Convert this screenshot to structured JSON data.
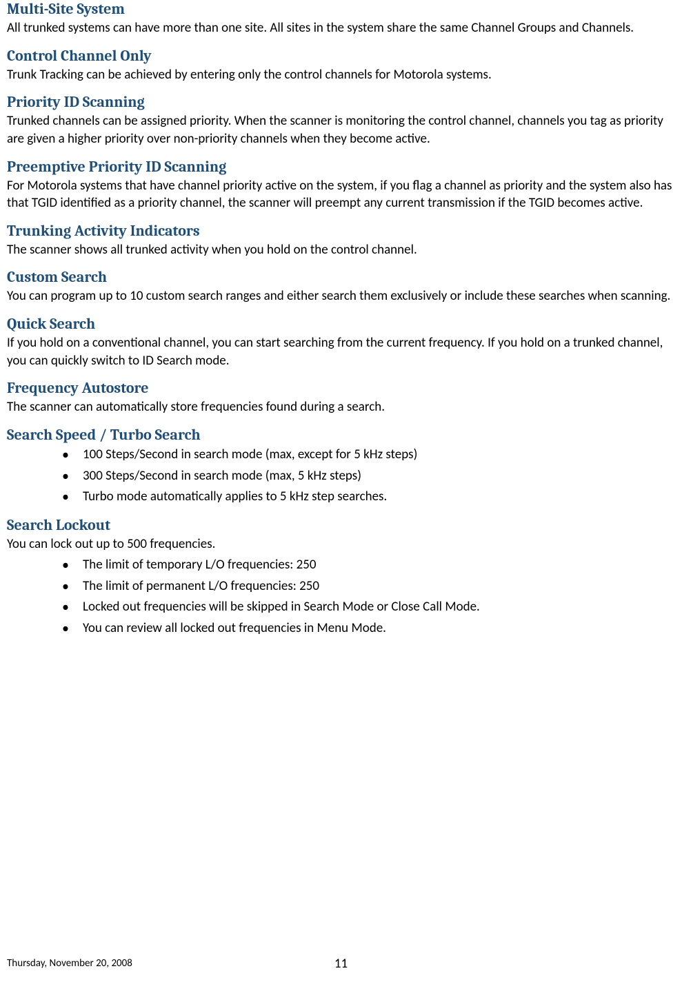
{
  "sections": [
    {
      "heading": "Multi-Site System",
      "body": "All trunked systems can have more than one site. All sites in the system share the same Channel Groups and Channels."
    },
    {
      "heading": "Control Channel Only",
      "body": "Trunk Tracking can be achieved by entering only the control channels for Motorola systems."
    },
    {
      "heading": "Priority ID Scanning",
      "body": "Trunked channels can be assigned priority. When the scanner is monitoring the control channel, channels you tag as priority are given a higher priority over non-priority channels when they become active."
    },
    {
      "heading": "Preemptive Priority ID Scanning",
      "body": "For Motorola systems that have channel priority active on the system, if you flag a channel as priority and the system also has that TGID identified as a priority channel, the scanner will preempt any current transmission if the TGID becomes active."
    },
    {
      "heading": "Trunking Activity Indicators",
      "body": "The scanner shows all trunked activity when you hold on the control channel."
    },
    {
      "heading": "Custom Search",
      "body": "You can program up to 10 custom search ranges and either search them exclusively or include these searches when scanning."
    },
    {
      "heading": "Quick Search",
      "body": "If you hold on a conventional channel, you can start searching from the current frequency. If you hold on a trunked channel, you can quickly switch to ID Search mode."
    },
    {
      "heading": "Frequency Autostore",
      "body": "The scanner can automatically store frequencies found during a search."
    },
    {
      "heading": "Search Speed / Turbo Search",
      "bullets": [
        "100 Steps/Second in search mode (max, except   for 5 kHz steps)",
        "300 Steps/Second in search mode (max, 5 kHz steps)",
        "Turbo mode automatically applies to 5 kHz step searches."
      ]
    },
    {
      "heading": "Search Lockout",
      "body": "You can lock out up to 500 frequencies.",
      "bullets": [
        "The limit of temporary L/O frequencies: 250",
        "The limit of permanent L/O frequencies: 250",
        "Locked out frequencies will be skipped in Search Mode or Close Call Mode.",
        "You can review all locked out frequencies in Menu Mode."
      ]
    }
  ],
  "footer": {
    "date": "Thursday, November 20, 2008",
    "page": "11"
  }
}
